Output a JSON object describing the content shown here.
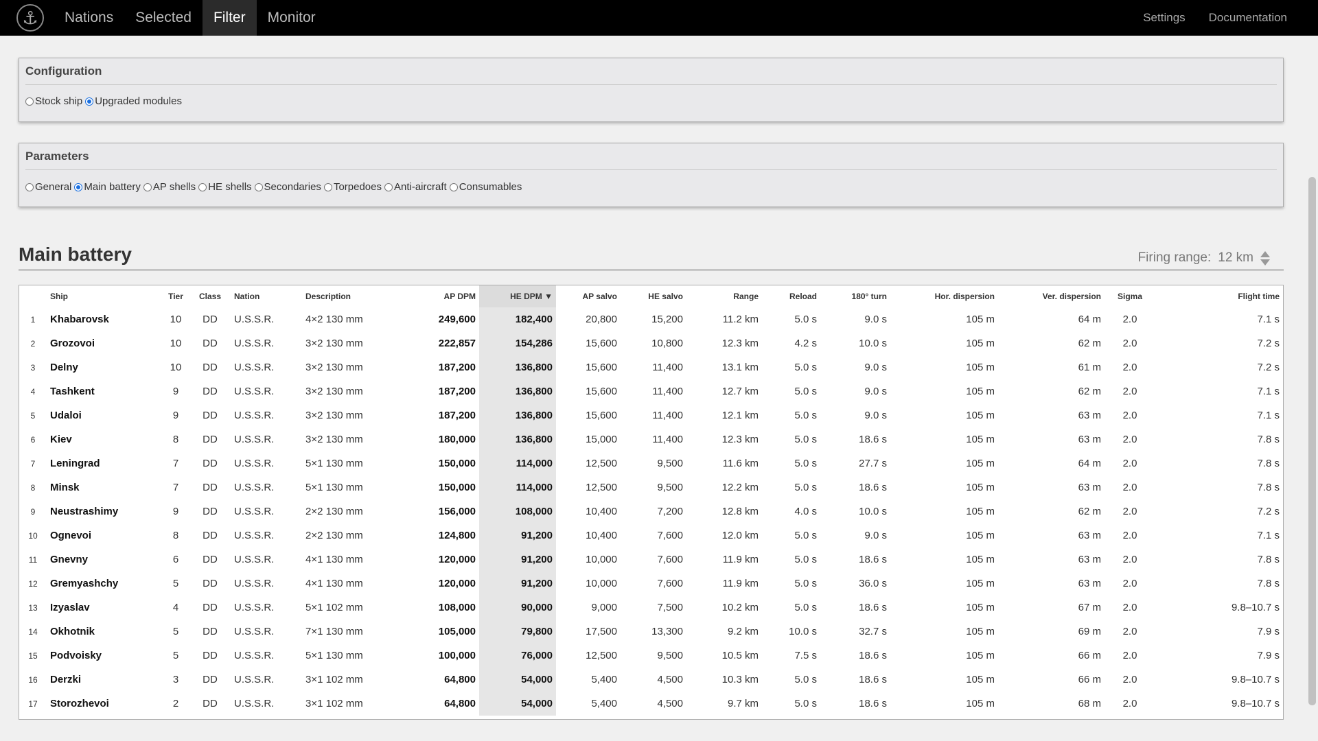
{
  "nav": {
    "logo_icon": "anchor-icon",
    "items": [
      {
        "label": "Nations",
        "active": false
      },
      {
        "label": "Selected",
        "active": false
      },
      {
        "label": "Filter",
        "active": true
      },
      {
        "label": "Monitor",
        "active": false
      }
    ],
    "right": [
      "Settings",
      "Documentation"
    ]
  },
  "configuration": {
    "title": "Configuration",
    "options": [
      "Stock ship",
      "Upgraded modules"
    ],
    "selected": "Upgraded modules"
  },
  "parameters": {
    "title": "Parameters",
    "options": [
      "General",
      "Main battery",
      "AP shells",
      "HE shells",
      "Secondaries",
      "Torpedoes",
      "Anti-aircraft",
      "Consumables"
    ],
    "selected": "Main battery"
  },
  "section": {
    "title": "Main battery",
    "range_label": "Firing range:",
    "range_value": "12 km"
  },
  "table": {
    "headers": [
      "",
      "Ship",
      "Tier",
      "Class",
      "Nation",
      "Description",
      "AP DPM",
      "HE DPM ▼",
      "AP salvo",
      "HE salvo",
      "Range",
      "Reload",
      "180° turn",
      "Hor. dispersion",
      "Ver. dispersion",
      "Sigma",
      "Flight time"
    ],
    "sort_column": 7,
    "rows": [
      [
        "1",
        "Khabarovsk",
        "10",
        "DD",
        "U.S.S.R.",
        "4×2 130 mm",
        "249,600",
        "182,400",
        "20,800",
        "15,200",
        "11.2 km",
        "5.0 s",
        "9.0 s",
        "105 m",
        "64 m",
        "2.0",
        "7.1 s"
      ],
      [
        "2",
        "Grozovoi",
        "10",
        "DD",
        "U.S.S.R.",
        "3×2 130 mm",
        "222,857",
        "154,286",
        "15,600",
        "10,800",
        "12.3 km",
        "4.2 s",
        "10.0 s",
        "105 m",
        "62 m",
        "2.0",
        "7.2 s"
      ],
      [
        "3",
        "Delny",
        "10",
        "DD",
        "U.S.S.R.",
        "3×2 130 mm",
        "187,200",
        "136,800",
        "15,600",
        "11,400",
        "13.1 km",
        "5.0 s",
        "9.0 s",
        "105 m",
        "61 m",
        "2.0",
        "7.2 s"
      ],
      [
        "4",
        "Tashkent",
        "9",
        "DD",
        "U.S.S.R.",
        "3×2 130 mm",
        "187,200",
        "136,800",
        "15,600",
        "11,400",
        "12.7 km",
        "5.0 s",
        "9.0 s",
        "105 m",
        "62 m",
        "2.0",
        "7.1 s"
      ],
      [
        "5",
        "Udaloi",
        "9",
        "DD",
        "U.S.S.R.",
        "3×2 130 mm",
        "187,200",
        "136,800",
        "15,600",
        "11,400",
        "12.1 km",
        "5.0 s",
        "9.0 s",
        "105 m",
        "63 m",
        "2.0",
        "7.1 s"
      ],
      [
        "6",
        "Kiev",
        "8",
        "DD",
        "U.S.S.R.",
        "3×2 130 mm",
        "180,000",
        "136,800",
        "15,000",
        "11,400",
        "12.3 km",
        "5.0 s",
        "18.6 s",
        "105 m",
        "63 m",
        "2.0",
        "7.8 s"
      ],
      [
        "7",
        "Leningrad",
        "7",
        "DD",
        "U.S.S.R.",
        "5×1 130 mm",
        "150,000",
        "114,000",
        "12,500",
        "9,500",
        "11.6 km",
        "5.0 s",
        "27.7 s",
        "105 m",
        "64 m",
        "2.0",
        "7.8 s"
      ],
      [
        "8",
        "Minsk",
        "7",
        "DD",
        "U.S.S.R.",
        "5×1 130 mm",
        "150,000",
        "114,000",
        "12,500",
        "9,500",
        "12.2 km",
        "5.0 s",
        "18.6 s",
        "105 m",
        "63 m",
        "2.0",
        "7.8 s"
      ],
      [
        "9",
        "Neustrashimy",
        "9",
        "DD",
        "U.S.S.R.",
        "2×2 130 mm",
        "156,000",
        "108,000",
        "10,400",
        "7,200",
        "12.8 km",
        "4.0 s",
        "10.0 s",
        "105 m",
        "62 m",
        "2.0",
        "7.2 s"
      ],
      [
        "10",
        "Ognevoi",
        "8",
        "DD",
        "U.S.S.R.",
        "2×2 130 mm",
        "124,800",
        "91,200",
        "10,400",
        "7,600",
        "12.0 km",
        "5.0 s",
        "9.0 s",
        "105 m",
        "63 m",
        "2.0",
        "7.1 s"
      ],
      [
        "11",
        "Gnevny",
        "6",
        "DD",
        "U.S.S.R.",
        "4×1 130 mm",
        "120,000",
        "91,200",
        "10,000",
        "7,600",
        "11.9 km",
        "5.0 s",
        "18.6 s",
        "105 m",
        "63 m",
        "2.0",
        "7.8 s"
      ],
      [
        "12",
        "Gremyashchy",
        "5",
        "DD",
        "U.S.S.R.",
        "4×1 130 mm",
        "120,000",
        "91,200",
        "10,000",
        "7,600",
        "11.9 km",
        "5.0 s",
        "36.0 s",
        "105 m",
        "63 m",
        "2.0",
        "7.8 s"
      ],
      [
        "13",
        "Izyaslav",
        "4",
        "DD",
        "U.S.S.R.",
        "5×1 102 mm",
        "108,000",
        "90,000",
        "9,000",
        "7,500",
        "10.2 km",
        "5.0 s",
        "18.6 s",
        "105 m",
        "67 m",
        "2.0",
        "9.8–10.7 s"
      ],
      [
        "14",
        "Okhotnik",
        "5",
        "DD",
        "U.S.S.R.",
        "7×1 130 mm",
        "105,000",
        "79,800",
        "17,500",
        "13,300",
        "9.2 km",
        "10.0 s",
        "32.7 s",
        "105 m",
        "69 m",
        "2.0",
        "7.9 s"
      ],
      [
        "15",
        "Podvoisky",
        "5",
        "DD",
        "U.S.S.R.",
        "5×1 130 mm",
        "100,000",
        "76,000",
        "12,500",
        "9,500",
        "10.5 km",
        "7.5 s",
        "18.6 s",
        "105 m",
        "66 m",
        "2.0",
        "7.9 s"
      ],
      [
        "16",
        "Derzki",
        "3",
        "DD",
        "U.S.S.R.",
        "3×1 102 mm",
        "64,800",
        "54,000",
        "5,400",
        "4,500",
        "10.3 km",
        "5.0 s",
        "18.6 s",
        "105 m",
        "66 m",
        "2.0",
        "9.8–10.7 s"
      ],
      [
        "17",
        "Storozhevoi",
        "2",
        "DD",
        "U.S.S.R.",
        "3×1 102 mm",
        "64,800",
        "54,000",
        "5,400",
        "4,500",
        "9.7 km",
        "5.0 s",
        "18.6 s",
        "105 m",
        "68 m",
        "2.0",
        "9.8–10.7 s"
      ]
    ]
  }
}
